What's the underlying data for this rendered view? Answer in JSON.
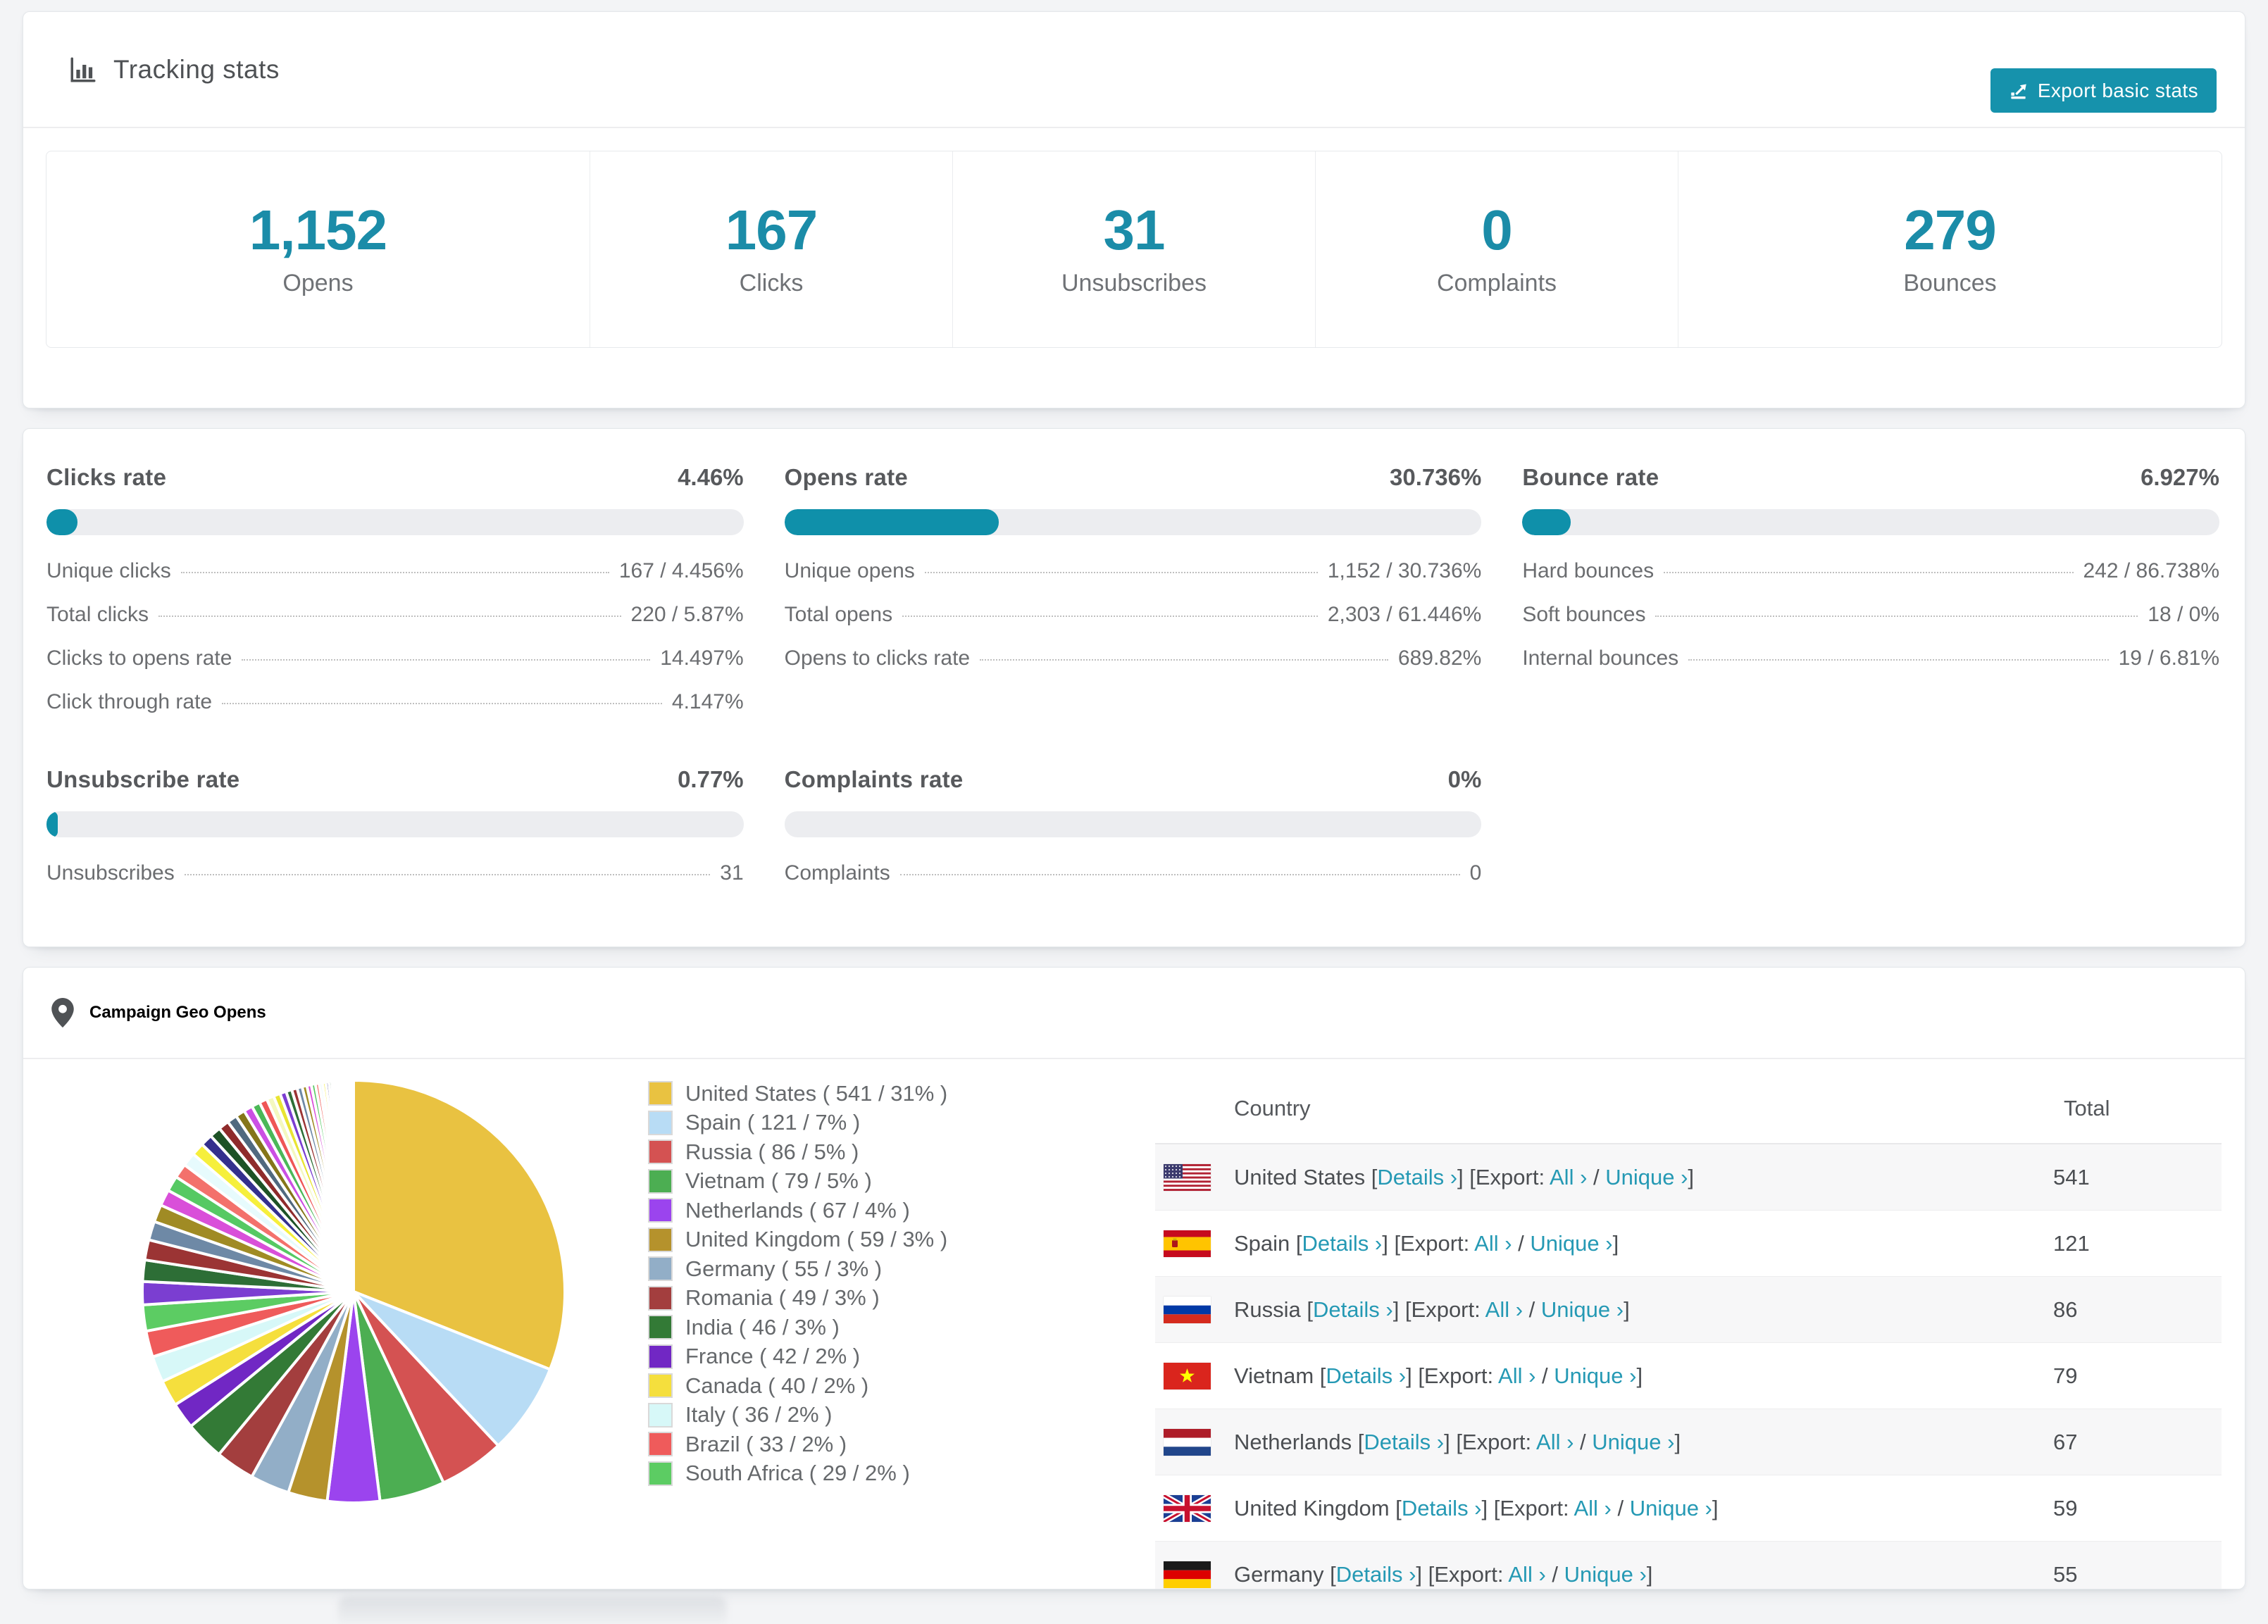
{
  "colors": {
    "accent_teal": "#1692ac",
    "number_teal": "#1b8ca8",
    "link_teal": "#2599b4",
    "progress_fill": "#0f90aa",
    "progress_track": "#ecedf0",
    "row_alt_bg": "#f7f7f8"
  },
  "tracking": {
    "title": "Tracking stats",
    "export_label": "Export basic stats",
    "stats": [
      {
        "value": "1,152",
        "label": "Opens"
      },
      {
        "value": "167",
        "label": "Clicks"
      },
      {
        "value": "31",
        "label": "Unsubscribes"
      },
      {
        "value": "0",
        "label": "Complaints"
      },
      {
        "value": "279",
        "label": "Bounces"
      }
    ]
  },
  "rates": {
    "blocks": [
      {
        "title": "Clicks rate",
        "value": "4.46%",
        "percent": 4.46,
        "rows": [
          {
            "label": "Unique clicks",
            "value": "167 / 4.456%"
          },
          {
            "label": "Total clicks",
            "value": "220 / 5.87%"
          },
          {
            "label": "Clicks to opens rate",
            "value": "14.497%"
          },
          {
            "label": "Click through rate",
            "value": "4.147%"
          }
        ]
      },
      {
        "title": "Opens rate",
        "value": "30.736%",
        "percent": 30.736,
        "rows": [
          {
            "label": "Unique opens",
            "value": "1,152 / 30.736%"
          },
          {
            "label": "Total opens",
            "value": "2,303 / 61.446%"
          },
          {
            "label": "Opens to clicks rate",
            "value": "689.82%"
          }
        ]
      },
      {
        "title": "Bounce rate",
        "value": "6.927%",
        "percent": 6.927,
        "rows": [
          {
            "label": "Hard bounces",
            "value": "242 / 86.738%"
          },
          {
            "label": "Soft bounces",
            "value": "18 / 0%"
          },
          {
            "label": "Internal bounces",
            "value": "19 / 6.81%"
          }
        ]
      },
      {
        "title": "Unsubscribe rate",
        "value": "0.77%",
        "percent": 0.77,
        "rows": [
          {
            "label": "Unsubscribes",
            "value": "31"
          }
        ]
      },
      {
        "title": "Complaints rate",
        "value": "0%",
        "percent": 0,
        "rows": [
          {
            "label": "Complaints",
            "value": "0"
          }
        ]
      }
    ]
  },
  "geo": {
    "title": "Campaign Geo Opens",
    "table": {
      "col_country": "Country",
      "col_total": "Total",
      "details_label": "Details ›",
      "export_label": "Export:",
      "all_label": "All ›",
      "unique_label": "Unique ›",
      "rows": [
        {
          "country": "United States",
          "flag": "us",
          "total": "541"
        },
        {
          "country": "Spain",
          "flag": "es",
          "total": "121"
        },
        {
          "country": "Russia",
          "flag": "ru",
          "total": "86"
        },
        {
          "country": "Vietnam",
          "flag": "vn",
          "total": "79"
        },
        {
          "country": "Netherlands",
          "flag": "nl",
          "total": "67"
        },
        {
          "country": "United Kingdom",
          "flag": "gb",
          "total": "59"
        },
        {
          "country": "Germany",
          "flag": "de",
          "total": "55"
        }
      ]
    }
  },
  "chart_data": {
    "type": "pie",
    "title": "Campaign Geo Opens",
    "legend_position": "right",
    "slices": [
      {
        "label": "United States",
        "count": 541,
        "pct": 31,
        "color": "#e9c241"
      },
      {
        "label": "Spain",
        "count": 121,
        "pct": 7,
        "color": "#b8dcf5"
      },
      {
        "label": "Russia",
        "count": 86,
        "pct": 5,
        "color": "#d45252"
      },
      {
        "label": "Vietnam",
        "count": 79,
        "pct": 5,
        "color": "#4cae52"
      },
      {
        "label": "Netherlands",
        "count": 67,
        "pct": 4,
        "color": "#9b44ee"
      },
      {
        "label": "United Kingdom",
        "count": 59,
        "pct": 3,
        "color": "#b5922c"
      },
      {
        "label": "Germany",
        "count": 55,
        "pct": 3,
        "color": "#92aec7"
      },
      {
        "label": "Romania",
        "count": 49,
        "pct": 3,
        "color": "#a33e3e"
      },
      {
        "label": "India",
        "count": 46,
        "pct": 3,
        "color": "#337a36"
      },
      {
        "label": "France",
        "count": 42,
        "pct": 2,
        "color": "#7127c4"
      },
      {
        "label": "Canada",
        "count": 40,
        "pct": 2,
        "color": "#f5df3d"
      },
      {
        "label": "Italy",
        "count": 36,
        "pct": 2,
        "color": "#d7f8f8"
      },
      {
        "label": "Brazil",
        "count": 33,
        "pct": 2,
        "color": "#ef5b5b"
      },
      {
        "label": "South Africa",
        "count": 29,
        "pct": 2,
        "color": "#5ccc63"
      }
    ],
    "other_slices_total_pct": 26,
    "other_slice_weights": [
      1.35,
      1.25,
      1.18,
      1.1,
      1.02,
      0.95,
      0.9,
      0.85,
      0.8,
      0.75,
      0.7,
      0.66,
      0.62,
      0.58,
      0.55,
      0.52,
      0.49,
      0.46,
      0.43,
      0.4,
      0.37,
      0.34,
      0.32,
      0.3,
      0.28,
      0.26,
      0.24,
      0.22,
      0.2,
      0.19,
      0.18,
      0.17,
      0.16,
      0.15,
      0.14,
      0.13,
      0.12,
      0.11,
      0.1,
      0.09,
      0.08,
      0.07,
      0.06,
      0.05
    ],
    "other_slice_palette": [
      "#7b3ed1",
      "#2d6e36",
      "#9b3434",
      "#6e89a6",
      "#a08b24",
      "#d94fd9",
      "#56c963",
      "#f3716c",
      "#e7fbfd",
      "#f6ef3c",
      "#34308d",
      "#1d5226",
      "#8f2b2b",
      "#50697f",
      "#857519",
      "#cb4fe3",
      "#4bb858",
      "#ef5656",
      "#f4f8c0",
      "#e9e432"
    ]
  }
}
